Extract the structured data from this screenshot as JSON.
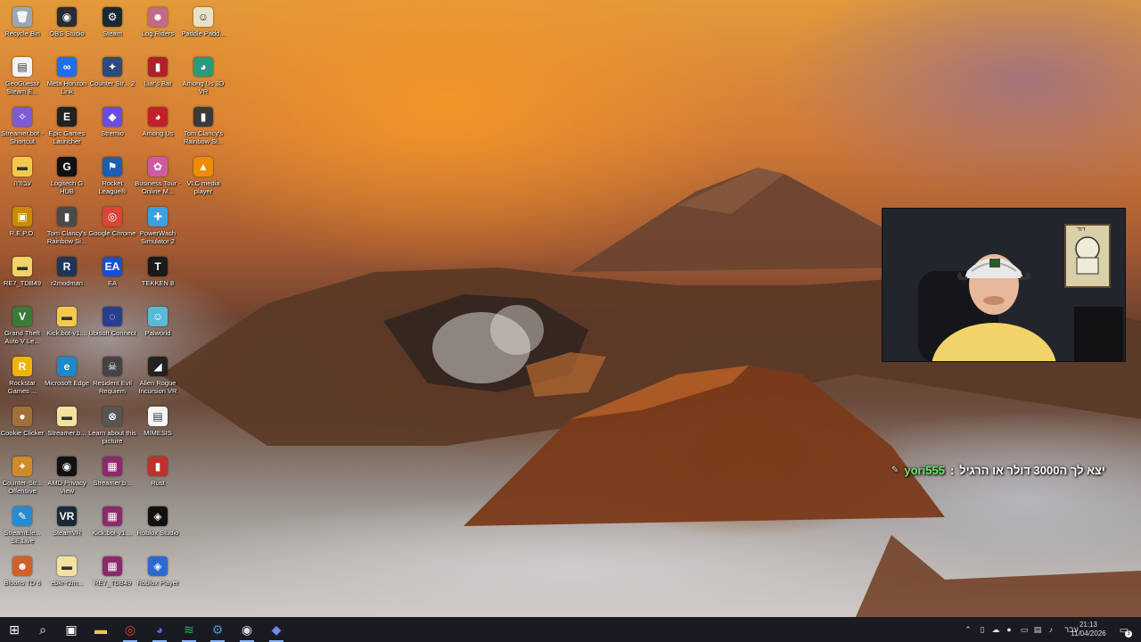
{
  "desktop": {
    "icons": [
      {
        "label": "Recycle Bin",
        "glyph": "🗑",
        "color": "#9aa7b5"
      },
      {
        "label": "OBS Studio",
        "glyph": "◉",
        "color": "#2b2b33"
      },
      {
        "label": "Steam",
        "glyph": "⚙",
        "color": "#1b2838"
      },
      {
        "label": "Log Riders",
        "glyph": "☻",
        "color": "#c06a8a"
      },
      {
        "label": "Paddle Padd...",
        "glyph": "☺",
        "color": "#e8e0c8"
      },
      {
        "label": "GeoGuessr Steam E...",
        "glyph": "▤",
        "color": "#f2f2f2"
      },
      {
        "label": "Meta Horizon Link",
        "glyph": "∞",
        "color": "#1f6feb"
      },
      {
        "label": "Counter Str... 2",
        "glyph": "✦",
        "color": "#2c4a7a"
      },
      {
        "label": "Liar's Bar",
        "glyph": "▮",
        "color": "#b0202a"
      },
      {
        "label": "Among Us 3D VR",
        "glyph": "◕",
        "color": "#2a9a7a"
      },
      {
        "label": "Streamer.bot - Shortcut",
        "glyph": "✧",
        "color": "#7b5cd6"
      },
      {
        "label": "Epic Games Launcher",
        "glyph": "E",
        "color": "#222222"
      },
      {
        "label": "Stremio",
        "glyph": "◆",
        "color": "#6b4be0"
      },
      {
        "label": "Among Us",
        "glyph": "◕",
        "color": "#c0202a"
      },
      {
        "label": "Tom Clancy's Rainbow Si...",
        "glyph": "▮",
        "color": "#3a3a3a"
      },
      {
        "label": "עבודה",
        "glyph": "▬",
        "color": "#f2c94c"
      },
      {
        "label": "Logitech G HUB",
        "glyph": "G",
        "color": "#111111"
      },
      {
        "label": "Rocket League®",
        "glyph": "⚑",
        "color": "#1a5fb4"
      },
      {
        "label": "Business Tour - Online M...",
        "glyph": "✿",
        "color": "#d05aa0"
      },
      {
        "label": "VLC media player",
        "glyph": "▲",
        "color": "#f08a00"
      },
      {
        "label": "R.E.P.O.",
        "glyph": "▣",
        "color": "#c78a00"
      },
      {
        "label": "Tom Clancy's Rainbow Si...",
        "glyph": "▮",
        "color": "#4a4a4a"
      },
      {
        "label": "Google Chrome",
        "glyph": "◎",
        "color": "#db4437"
      },
      {
        "label": "PowerWash Simulator 2",
        "glyph": "✚",
        "color": "#3aa0e0"
      },
      {
        "label": "",
        "glyph": "",
        "color": "transparent"
      },
      {
        "label": "RE7_TDB49",
        "glyph": "▬",
        "color": "#f2d36b"
      },
      {
        "label": "r2modman",
        "glyph": "R",
        "color": "#1d3557"
      },
      {
        "label": "EA",
        "glyph": "EA",
        "color": "#1a4fd1"
      },
      {
        "label": "TEKKEN 8",
        "glyph": "T",
        "color": "#1a1a1a"
      },
      {
        "label": "",
        "glyph": "",
        "color": "transparent"
      },
      {
        "label": "Grand Theft Auto V Le...",
        "glyph": "V",
        "color": "#3a7a3a"
      },
      {
        "label": "Kick.bot-v1....",
        "glyph": "▬",
        "color": "#f2c94c"
      },
      {
        "label": "Ubisoft Connect",
        "glyph": "◌",
        "color": "#2a3e8f"
      },
      {
        "label": "Palworld",
        "glyph": "☺",
        "color": "#5ab9d6"
      },
      {
        "label": "",
        "glyph": "",
        "color": "transparent"
      },
      {
        "label": "Rockstar Games ...",
        "glyph": "R",
        "color": "#f0b400"
      },
      {
        "label": "Microsoft Edge",
        "glyph": "e",
        "color": "#1e88c8"
      },
      {
        "label": "Resident Evil Requiem",
        "glyph": "☠",
        "color": "#444444"
      },
      {
        "label": "Alien Rogue Incursion VR",
        "glyph": "◢",
        "color": "#222222"
      },
      {
        "label": "",
        "glyph": "",
        "color": "transparent"
      },
      {
        "label": "Cookie Clicker",
        "glyph": "●",
        "color": "#a0703a"
      },
      {
        "label": "Streamer.b...",
        "glyph": "▬",
        "color": "#f2e2a0"
      },
      {
        "label": "Learn about this picture",
        "glyph": "⊗",
        "color": "#555555"
      },
      {
        "label": "MIMESIS",
        "glyph": "▤",
        "color": "#f5f5f5"
      },
      {
        "label": "",
        "glyph": "",
        "color": "transparent"
      },
      {
        "label": "Counter-Str... Offensive",
        "glyph": "✦",
        "color": "#d08a2a"
      },
      {
        "label": "AMD Privacy View",
        "glyph": "◉",
        "color": "#111111"
      },
      {
        "label": "Streamer.b...",
        "glyph": "▦",
        "color": "#8a2a6a"
      },
      {
        "label": "Rust",
        "glyph": "▮",
        "color": "#c0302a"
      },
      {
        "label": "",
        "glyph": "",
        "color": "transparent"
      },
      {
        "label": "StreamEle... SE.Live",
        "glyph": "✎",
        "color": "#2a8ad0"
      },
      {
        "label": "SteamVR",
        "glyph": "VR",
        "color": "#1b2838"
      },
      {
        "label": "Kick.bot-v1....",
        "glyph": "▦",
        "color": "#8a2a6a"
      },
      {
        "label": "Roblox Studio",
        "glyph": "◈",
        "color": "#111111"
      },
      {
        "label": "",
        "glyph": "",
        "color": "transparent"
      },
      {
        "label": "Bloons TD 6",
        "glyph": "☻",
        "color": "#d0602a"
      },
      {
        "label": "ebkr-r2m...",
        "glyph": "▬",
        "color": "#f2e2a0"
      },
      {
        "label": "RE7_TDB49",
        "glyph": "▦",
        "color": "#8a2a6a"
      },
      {
        "label": "Roblox Player",
        "glyph": "◈",
        "color": "#2a6ad0"
      }
    ]
  },
  "chat": {
    "username": "yori555",
    "separator": ":",
    "message": "יצא לך ה3000 דולר או הרגיל",
    "badge_icon": "bot-badge-icon"
  },
  "webcam": {
    "poster_text": "דוד"
  },
  "taskbar": {
    "apps": [
      {
        "name": "start-button",
        "glyph": "⊞",
        "color": "#ffffff"
      },
      {
        "name": "search-icon",
        "glyph": "⌕",
        "color": "#ffffff"
      },
      {
        "name": "task-view-icon",
        "glyph": "▣",
        "color": "#ffffff"
      },
      {
        "name": "file-explorer-icon",
        "glyph": "▬",
        "color": "#f2c94c"
      },
      {
        "name": "chrome-icon",
        "glyph": "◎",
        "color": "#db4437"
      },
      {
        "name": "discord-icon",
        "glyph": "◕",
        "color": "#5865f2"
      },
      {
        "name": "spotify-icon",
        "glyph": "≋",
        "color": "#1db954"
      },
      {
        "name": "steam-icon",
        "glyph": "⚙",
        "color": "#4a90d9"
      },
      {
        "name": "obs-icon",
        "glyph": "◉",
        "color": "#dddddd"
      },
      {
        "name": "streamer-bot-icon",
        "glyph": "◆",
        "color": "#6b8cf0"
      }
    ],
    "language": "עבר",
    "time": "21:13",
    "date": "11/04/2026",
    "notification_count": "3"
  }
}
